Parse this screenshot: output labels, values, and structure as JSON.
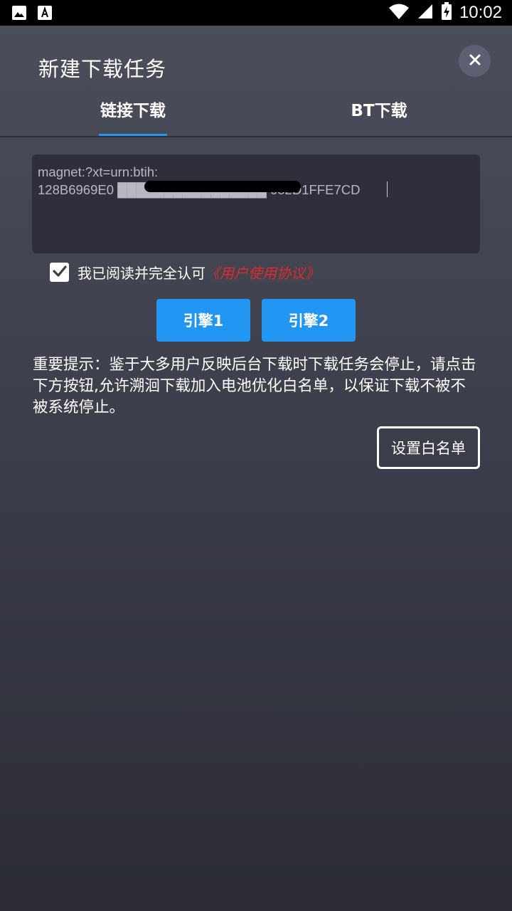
{
  "status_bar": {
    "time": "10:02",
    "left_icons": [
      "image-icon",
      "font-icon"
    ],
    "right_icons": [
      "wifi-icon",
      "signal-icon",
      "battery-charging-icon"
    ]
  },
  "dialog": {
    "title": "新建下载任务",
    "close_icon": "close-icon"
  },
  "tabs": [
    {
      "label": "链接下载",
      "active": true
    },
    {
      "label": "BT下载",
      "active": false
    }
  ],
  "link_input": {
    "value": "magnet:?xt=urn:btih:\n128B6969E0 ████████████████ 082D1FFE7CD"
  },
  "agreement": {
    "checked": true,
    "text": "我已阅读并完全认可",
    "link": "《用户使用协议》"
  },
  "engines": [
    {
      "label": "引擎1"
    },
    {
      "label": "引擎2"
    }
  ],
  "notice": "重要提示：鉴于大多用户反映后台下载时下载任务会停止，请点击下方按钮,允许溯洄下载加入电池优化白名单，以保证下载不被不被系统停止。",
  "whitelist_button": "设置白名单",
  "colors": {
    "accent": "#2196f3",
    "link_red": "#e02b2b",
    "input_bg": "#2e2f3a"
  }
}
